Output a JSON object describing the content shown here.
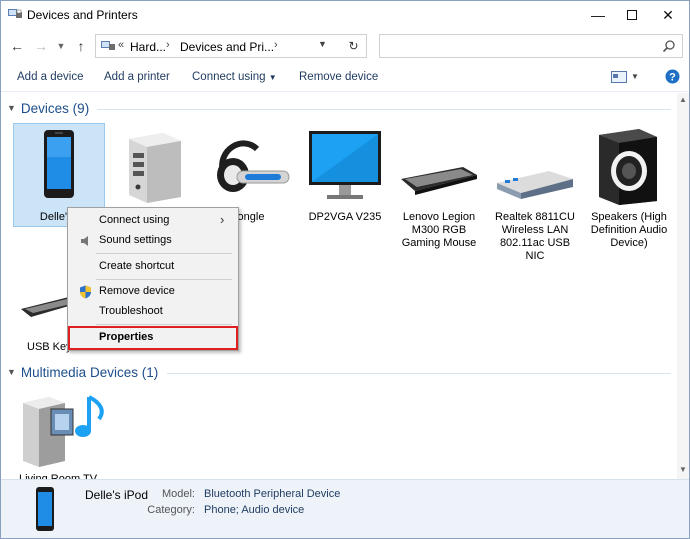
{
  "window": {
    "title": "Devices and Printers"
  },
  "address": {
    "crumb1": "Hard...",
    "crumb2": "Devices and Pri...",
    "search_placeholder": ""
  },
  "commands": {
    "add_device": "Add a device",
    "add_printer": "Add a printer",
    "connect_using": "Connect using",
    "remove_device": "Remove device"
  },
  "groups": {
    "devices": "Devices (9)",
    "multimedia": "Multimedia Devices (1)"
  },
  "devices": [
    {
      "label": "Delle's i"
    },
    {
      "label": ""
    },
    {
      "label": "ongle"
    },
    {
      "label": "DP2VGA V235"
    },
    {
      "label": "Lenovo Legion M300 RGB Gaming Mouse"
    },
    {
      "label": "Realtek 8811CU Wireless LAN 802.11ac USB NIC"
    },
    {
      "label": "Speakers (High Definition Audio Device)"
    },
    {
      "label": "USB Key"
    }
  ],
  "multimedia_devices": [
    {
      "label": "Living Room TV"
    }
  ],
  "context_menu": {
    "connect_using": "Connect using",
    "sound_settings": "Sound settings",
    "create_shortcut": "Create shortcut",
    "remove_device": "Remove device",
    "troubleshoot": "Troubleshoot",
    "properties": "Properties"
  },
  "details": {
    "name": "Delle's iPod",
    "model_key": "Model:",
    "model_val": "Bluetooth Peripheral Device",
    "category_key": "Category:",
    "category_val": "Phone; Audio device"
  },
  "colors": {
    "accent": "#1e4e8c",
    "selection": "#cce4f7",
    "highlight_border": "#e02020",
    "details_bg": "#eef3fa"
  }
}
